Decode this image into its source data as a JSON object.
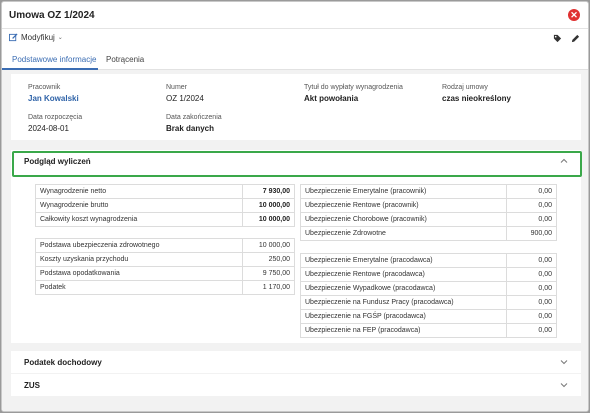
{
  "window": {
    "title": "Umowa OZ 1/2024"
  },
  "toolbar": {
    "modify_label": "Modyfikuj",
    "modify_caret": "⌄"
  },
  "tabs": [
    {
      "label": "Podstawowe informacje",
      "active": true
    },
    {
      "label": "Potrącenia",
      "active": false
    }
  ],
  "info": {
    "employee_label": "Pracownik",
    "employee_value": "Jan Kowalski",
    "number_label": "Numer",
    "number_value": "OZ 1/2024",
    "title_label": "Tytuł do wypłaty wynagrodzenia",
    "title_value": "Akt powołania",
    "type_label": "Rodzaj umowy",
    "type_value": "czas nieokreślony",
    "start_label": "Data rozpoczęcia",
    "start_value": "2024-08-01",
    "end_label": "Data zakończenia",
    "end_value": "Brak danych"
  },
  "sections": {
    "preview_title": "Podgląd wyliczeń",
    "income_tax_title": "Podatek dochodowy",
    "zus_title": "ZUS"
  },
  "left_table_1": [
    {
      "label": "Wynagrodzenie netto",
      "value": "7 930,00"
    },
    {
      "label": "Wynagrodzenie brutto",
      "value": "10 000,00"
    },
    {
      "label": "Całkowity koszt wynagrodzenia",
      "value": "10 000,00"
    }
  ],
  "left_table_2": [
    {
      "label": "Podstawa ubezpieczenia zdrowotnego",
      "value": "10 000,00"
    },
    {
      "label": "Koszty uzyskania przychodu",
      "value": "250,00"
    },
    {
      "label": "Podstawa opodatkowania",
      "value": "9 750,00"
    },
    {
      "label": "Podatek",
      "value": "1 170,00"
    }
  ],
  "right_table_1": [
    {
      "label": "Ubezpieczenie Emerytalne (pracownik)",
      "value": "0,00"
    },
    {
      "label": "Ubezpieczenie Rentowe (pracownik)",
      "value": "0,00"
    },
    {
      "label": "Ubezpieczenie Chorobowe (pracownik)",
      "value": "0,00"
    },
    {
      "label": "Ubezpieczenie Zdrowotne",
      "value": "900,00"
    }
  ],
  "right_table_2": [
    {
      "label": "Ubezpieczenie Emerytalne (pracodawca)",
      "value": "0,00"
    },
    {
      "label": "Ubezpieczenie Rentowe (pracodawca)",
      "value": "0,00"
    },
    {
      "label": "Ubezpieczenie Wypadkowe (pracodawca)",
      "value": "0,00"
    },
    {
      "label": "Ubezpieczenie na Fundusz Pracy (pracodawca)",
      "value": "0,00"
    },
    {
      "label": "Ubezpieczenie na FGŚP (pracodawca)",
      "value": "0,00"
    },
    {
      "label": "Ubezpieczenie na FEP (pracodawca)",
      "value": "0,00"
    }
  ],
  "colors": {
    "accent": "#3b6db3",
    "highlight": "#3aa84a",
    "close": "#e03131"
  }
}
